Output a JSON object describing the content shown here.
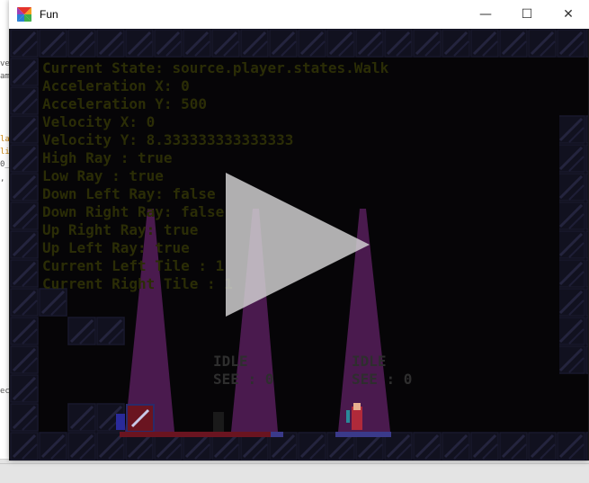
{
  "window": {
    "title": "Fun",
    "controls": {
      "minimize": "—",
      "maximize": "☐",
      "close": "✕"
    }
  },
  "editor_fragments": [
    "ve",
    "am",
    "la",
    "li",
    "0_",
    ",",
    "ec"
  ],
  "debug_lines": [
    "Current State: source.player.states.Walk",
    "Acceleration X: 0",
    "Acceleration Y: 500",
    "Velocity X: 0",
    "Velocity Y: 8.333333333333333",
    "High Ray : true",
    "Low Ray : true",
    "Down Left Ray: false",
    "Down Right Ray: false",
    "Up Right Ray: true",
    "Up Left Ray: true",
    "Current Left Tile : 1",
    "Current Right Tile : 1"
  ],
  "npcs": [
    {
      "state": "IDLE",
      "see": "SEE : 0"
    },
    {
      "state": "IDLE",
      "see": "SEE : 0"
    }
  ],
  "icons": {
    "app": "kite-logo-icon",
    "play": "play-icon"
  },
  "colors": {
    "beam": "#4a1a4e",
    "debug_text": "#2b2d06",
    "tile": "#101020",
    "tile_stripe": "#2a2a4a"
  }
}
